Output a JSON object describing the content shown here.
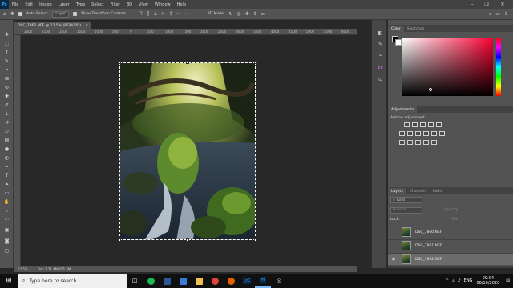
{
  "menubar": {
    "logo": "Ps",
    "items": [
      "File",
      "Edit",
      "Image",
      "Layer",
      "Type",
      "Select",
      "Filter",
      "3D",
      "View",
      "Window",
      "Help"
    ]
  },
  "options": {
    "auto_select_label": "Auto-Select:",
    "auto_select_value": "Layer",
    "transform_label": "Show Transform Controls",
    "mode_label": "3D Mode:"
  },
  "document": {
    "tab_title": "DSC_7862.NEF @ 12.5% (RGB/16*)",
    "close": "×",
    "zoom": "12.5%",
    "doc_size": "Doc: 124.4M/425.3M",
    "ruler_ticks": [
      "3000",
      "2500",
      "2000",
      "1500",
      "1000",
      "500",
      "0",
      "500",
      "1000",
      "1500",
      "2000",
      "2500",
      "3000",
      "3500",
      "4000",
      "4500",
      "5000",
      "5500",
      "6000"
    ]
  },
  "panels": {
    "color_tabs": [
      "Color",
      "Swatches"
    ],
    "adjustments_tab": "Adjustments",
    "adjustments_hint": "Add an adjustment",
    "layers_tabs": [
      "Layers",
      "Channels",
      "Paths"
    ],
    "kind_label": "Kind",
    "blend_mode": "Normal",
    "opacity_label": "Opacity:",
    "lock_label": "Lock:",
    "fill_label": "Fill:",
    "layers": [
      {
        "name": "DSC_7860.NEF",
        "visible": false
      },
      {
        "name": "DSC_7861.NEF",
        "visible": false
      },
      {
        "name": "DSC_7862.NEF",
        "visible": true
      }
    ]
  },
  "taskbar": {
    "search_placeholder": "Type here to search",
    "lr_label": "LrC",
    "ps_label": "Ps",
    "lang": "ENG",
    "time": "09:04",
    "date": "06/10/2020"
  },
  "colors": {
    "accent": "#31a8ff",
    "panel_bg": "#535353",
    "canvas_bg": "#282828"
  }
}
